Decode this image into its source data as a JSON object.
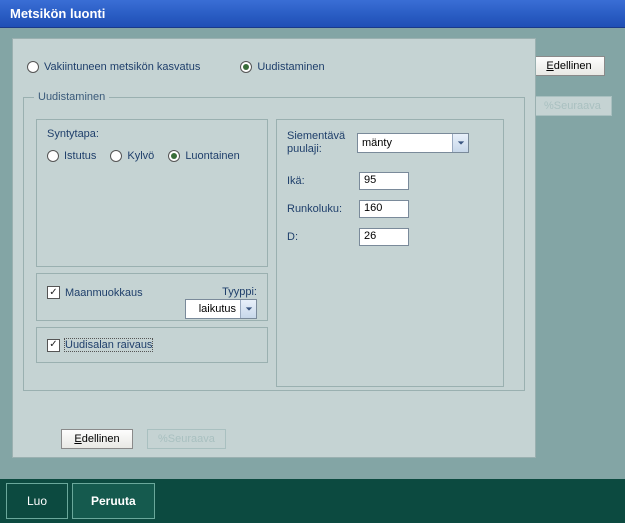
{
  "window": {
    "title": "Metsikön luonti"
  },
  "rightButtons": {
    "prev": "Edellinen",
    "next": "%Seuraava"
  },
  "method": {
    "vakiintunut": "Vakiintuneen metsikön kasvatus",
    "uudistaminen": "Uudistaminen",
    "selected": "uudistaminen"
  },
  "uudistaminen": {
    "legend": "Uudistaminen",
    "syntytapa": {
      "label": "Syntytapa:",
      "options": {
        "istutus": "Istutus",
        "kylvo": "Kylvö",
        "luontainen": "Luontainen"
      },
      "selected": "luontainen"
    },
    "maanmuokkaus": {
      "label": "Maanmuokkaus",
      "checked": true,
      "tyyppiLabel": "Tyyppi:",
      "tyyppiValue": "laikutus"
    },
    "raivaus": {
      "label": "Uudisalan raivaus",
      "checked": true
    },
    "species": {
      "label": "Siementävä puulaji:",
      "value": "mänty"
    },
    "fields": {
      "ikaLabel": "Ikä:",
      "ikaValue": "95",
      "runkolukuLabel": "Runkoluku:",
      "runkolukuValue": "160",
      "dLabel": "D:",
      "dValue": "26"
    }
  },
  "bottomButtons": {
    "prev": "Edellinen",
    "next": "%Seuraava"
  },
  "footer": {
    "luo": "Luo",
    "peruuta": "Peruuta"
  }
}
